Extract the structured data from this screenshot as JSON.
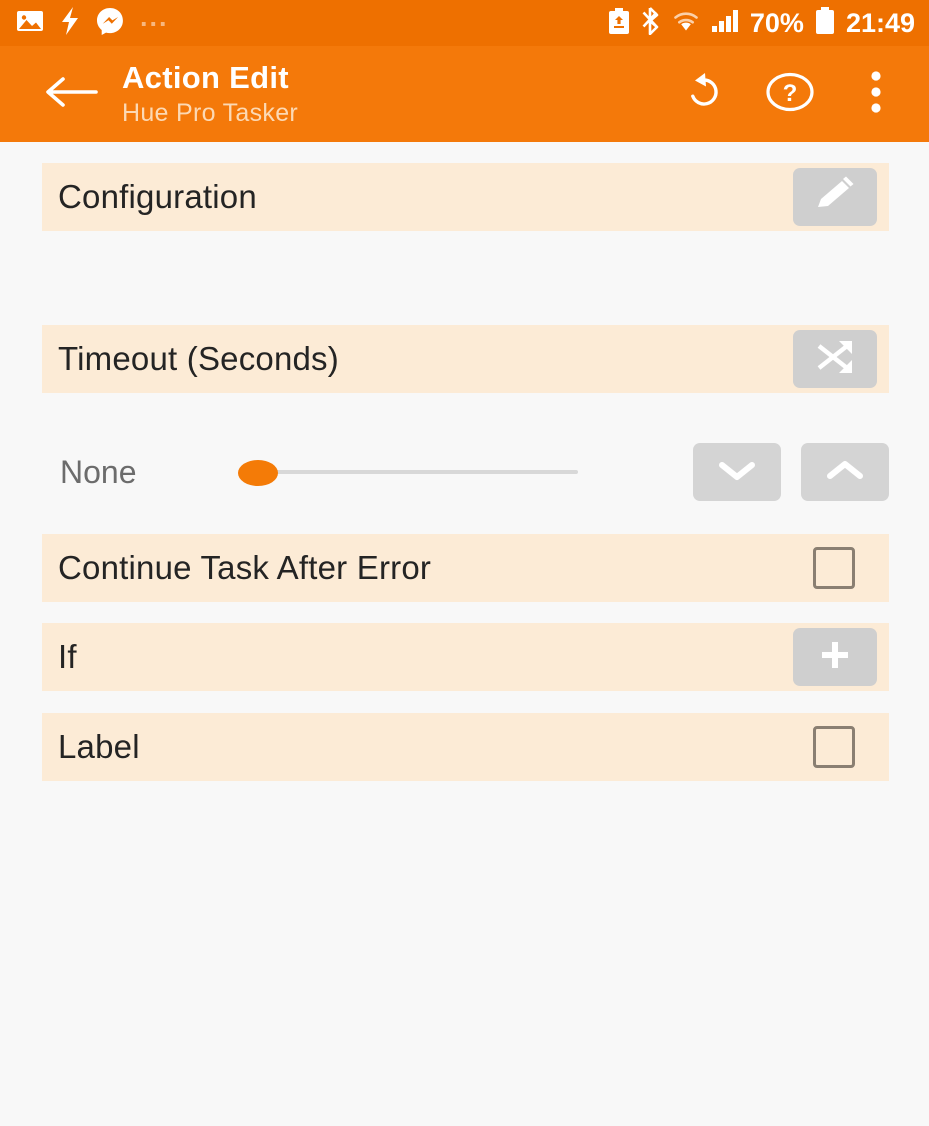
{
  "statusbar": {
    "left_icons": [
      "photo-icon",
      "flash-icon",
      "messenger-icon"
    ],
    "overflow_text": "...",
    "right_icons": [
      "battery-saver-icon",
      "bluetooth-icon",
      "wifi-icon",
      "signal-icon"
    ],
    "battery_percent": "70%",
    "battery_icon": "battery-icon",
    "clock": "21:49",
    "background_color": "#ee7000"
  },
  "appbar": {
    "back_icon": "back-arrow-icon",
    "title": "Action Edit",
    "subtitle": "Hue Pro Tasker",
    "actions": [
      {
        "name": "undo-button",
        "icon": "undo-icon"
      },
      {
        "name": "help-button",
        "icon": "help-circle-icon"
      },
      {
        "name": "overflow-button",
        "icon": "more-vertical-icon"
      }
    ],
    "background_color": "#f4790a",
    "title_color": "#ffffff",
    "subtitle_color": "#fcd9b4"
  },
  "theme": {
    "row_background": "#fcebd6",
    "page_background": "#f8f8f8",
    "accent": "#f47b07",
    "button_gray": "#cfcfcf",
    "label_color": "#242424"
  },
  "rows": [
    {
      "label": "Configuration",
      "control": "edit-pencil-button",
      "icon": "pencil-icon"
    },
    {
      "label": "Timeout (Seconds)",
      "control": "variable-shuffle-button",
      "icon": "shuffle-icon"
    },
    {
      "label": "Continue Task After Error",
      "control": "checkbox",
      "checked": false
    },
    {
      "label": "If",
      "control": "add-button",
      "icon": "plus-icon"
    },
    {
      "label": "Label",
      "control": "checkbox",
      "checked": false
    }
  ],
  "timeout_slider": {
    "value_label": "None",
    "value": 0,
    "min": 0,
    "max": 100,
    "decrement_icon": "chevron-down-icon",
    "increment_icon": "chevron-up-icon"
  }
}
